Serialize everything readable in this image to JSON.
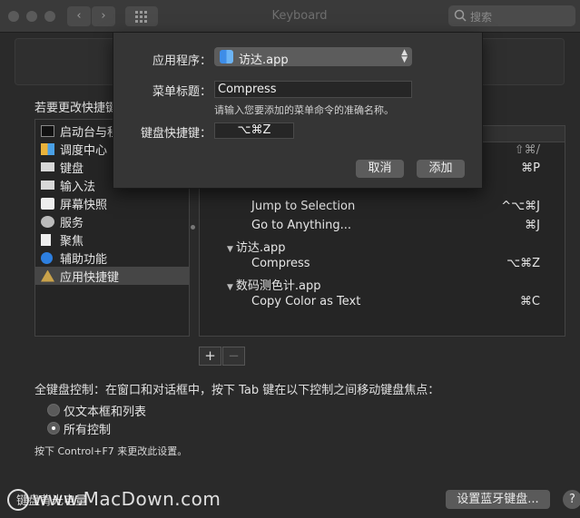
{
  "window": {
    "title": "Keyboard"
  },
  "search": {
    "placeholder": "搜索"
  },
  "main": {
    "instruction": "若要更改快捷键",
    "categories": [
      {
        "label": "启动台与程",
        "icon": "launchpad-icon"
      },
      {
        "label": "调度中心",
        "icon": "mission-control-icon"
      },
      {
        "label": "键盘",
        "icon": "keyboard-icon"
      },
      {
        "label": "输入法",
        "icon": "input-method-icon"
      },
      {
        "label": "屏幕快照",
        "icon": "screenshot-icon"
      },
      {
        "label": "服务",
        "icon": "gear-icon"
      },
      {
        "label": "聚焦",
        "icon": "spotlight-icon"
      },
      {
        "label": "辅助功能",
        "icon": "accessibility-icon"
      },
      {
        "label": "应用快捷键",
        "icon": "app-shortcuts-icon"
      }
    ],
    "shortcuts": [
      {
        "label": "",
        "key": "⇧⌘/"
      },
      {
        "label": "",
        "key": "⌘P"
      },
      {
        "label": "Jump to Selection",
        "key": "^⌥⌘J"
      },
      {
        "label": "Go to Anything...",
        "key": "⌘J"
      },
      {
        "label": "访达.app",
        "key": ""
      },
      {
        "label": "Compress",
        "key": "⌥⌘Z"
      },
      {
        "label": "数码测色计.app",
        "key": ""
      },
      {
        "label": "Copy Color as Text",
        "key": "⌘C"
      }
    ],
    "add_label": "+",
    "remove_label": "−",
    "fkc_label": "全键盘控制：在窗口和对话框中，按下 Tab 键在以下控制之间移动键盘焦点：",
    "radio_text_only": "仅文本框和列表",
    "radio_all": "所有控制",
    "hint": "按下 Control+F7 来更改此设置。"
  },
  "bottom": {
    "partial_label": "键盘背光电量",
    "watermark": "www.MacDown.com",
    "bluetooth_btn": "设置蓝牙键盘...",
    "help": "?"
  },
  "dialog": {
    "app_label": "应用程序：",
    "app_value": "访达.app",
    "menu_title_label": "菜单标题：",
    "menu_title_value": "Compress",
    "menu_hint": "请输入您要添加的菜单命令的准确名称。",
    "shortcut_label": "键盘快捷键：",
    "shortcut_value": "⌥⌘Z",
    "cancel": "取消",
    "add": "添加"
  }
}
